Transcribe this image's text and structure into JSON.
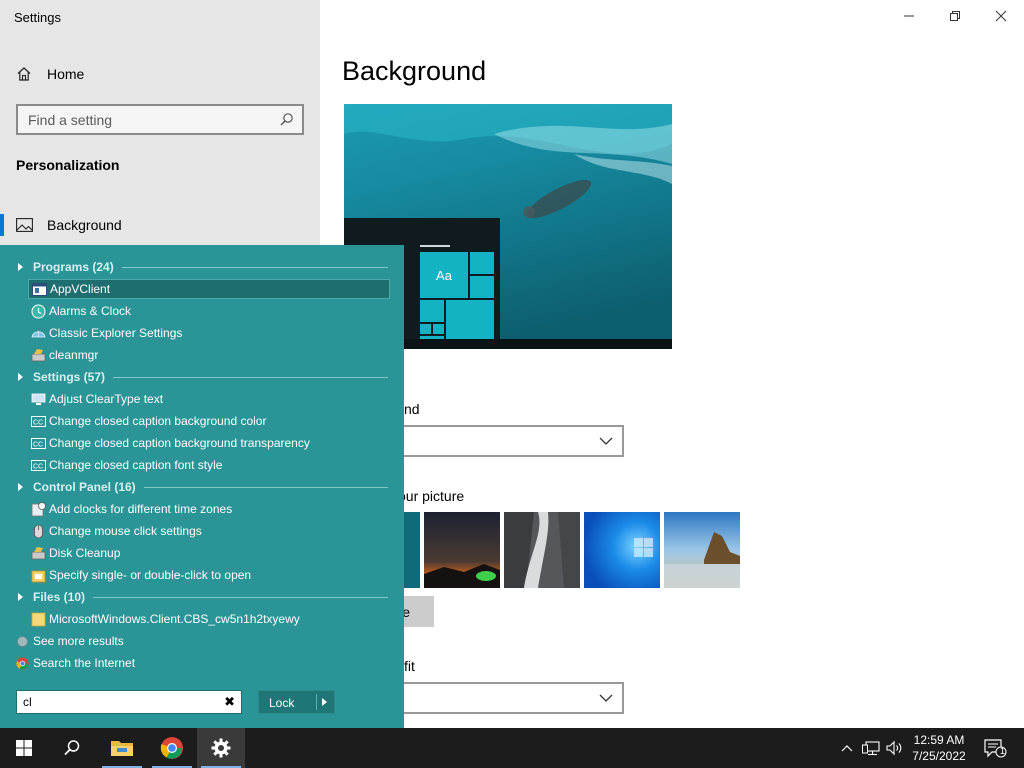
{
  "window": {
    "title": "Settings",
    "controls": {
      "minimize": "minimize-icon",
      "maximize": "restore-icon",
      "close": "close-icon"
    }
  },
  "sidebar": {
    "home_label": "Home",
    "search_placeholder": "Find a setting",
    "section_title": "Personalization",
    "items": [
      {
        "label": "Background",
        "icon": "picture-icon",
        "selected": true
      }
    ]
  },
  "main": {
    "title": "Background",
    "background_label_fragment": "nd",
    "choose_picture_fragment": "our picture",
    "browse_fragment": "e",
    "fit_label_fragment": "fit",
    "preview_tile_text": "Aa"
  },
  "start_search": {
    "groups": [
      {
        "title": "Programs (24)",
        "items": [
          {
            "label": "AppVClient",
            "icon": "app-window-icon",
            "selected": true
          },
          {
            "label": "Alarms & Clock",
            "icon": "alarm-clock-icon"
          },
          {
            "label": "Classic Explorer Settings",
            "icon": "shell-icon"
          },
          {
            "label": "cleanmgr",
            "icon": "disk-cleanup-icon"
          }
        ]
      },
      {
        "title": "Settings (57)",
        "items": [
          {
            "label": "Adjust ClearType text",
            "icon": "monitor-icon"
          },
          {
            "label": "Change closed caption background color",
            "icon": "cc-icon"
          },
          {
            "label": "Change closed caption background transparency",
            "icon": "cc-icon"
          },
          {
            "label": "Change closed caption font style",
            "icon": "cc-icon"
          }
        ]
      },
      {
        "title": "Control Panel (16)",
        "items": [
          {
            "label": "Add clocks for different time zones",
            "icon": "clock-icon"
          },
          {
            "label": "Change mouse click settings",
            "icon": "mouse-icon"
          },
          {
            "label": "Disk Cleanup",
            "icon": "disk-cleanup-icon"
          },
          {
            "label": "Specify single- or double-click to open",
            "icon": "folder-options-icon"
          }
        ]
      },
      {
        "title": "Files (10)",
        "items": [
          {
            "label": "MicrosoftWindows.Client.CBS_cw5n1h2txyewy",
            "icon": "folder-icon"
          }
        ]
      }
    ],
    "see_more": "See more results",
    "search_internet": "Search the Internet",
    "query": "cl",
    "clear_glyph": "✖",
    "lock_label": "Lock"
  },
  "taskbar": {
    "apps": [
      "windows-start-icon",
      "search-icon",
      "file-explorer-icon",
      "chrome-icon",
      "settings-gear-icon"
    ],
    "time": "12:59 AM",
    "date": "7/25/2022",
    "notification_count": "1"
  },
  "colors": {
    "start_bg": "#2a9497",
    "accent": "#0078d7",
    "taskbar_bg": "#1c1c1c",
    "sidebar_bg": "#e6e6e6"
  }
}
